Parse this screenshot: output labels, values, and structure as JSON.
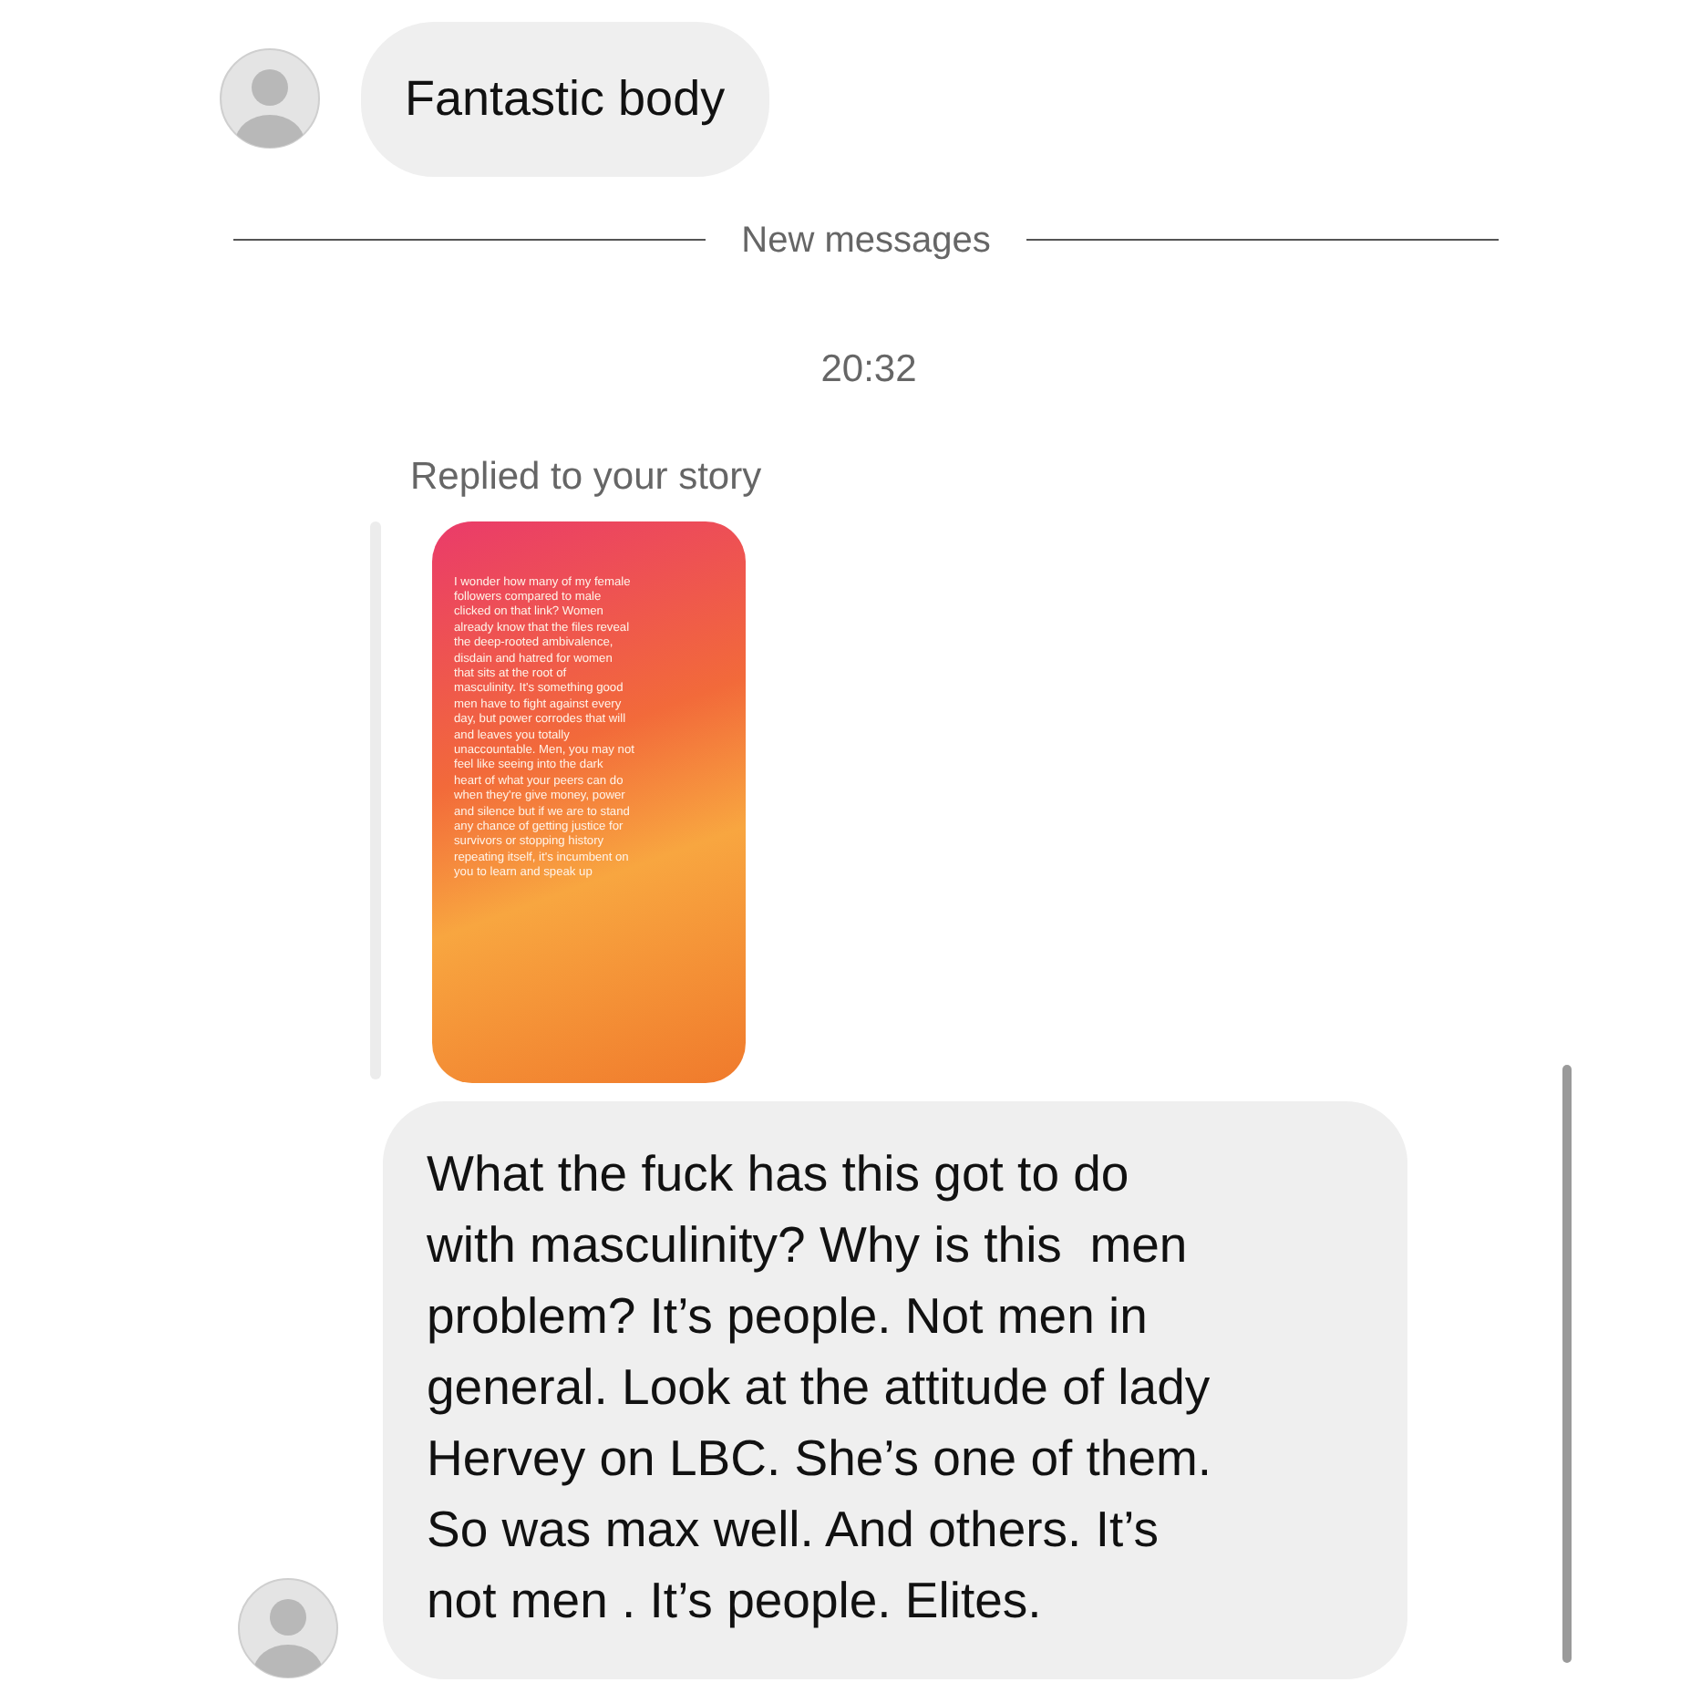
{
  "messages_before": [
    {
      "text": "Fantastic body"
    }
  ],
  "divider": {
    "label": "New messages"
  },
  "timestamp": "20:32",
  "story_reply": {
    "label": "Replied to your story",
    "story_lines": [
      "I wonder how many of my female",
      "followers compared to male",
      "clicked on that link? Women",
      "already know that the files reveal",
      "the deep-rooted ambivalence,",
      "disdain and hatred for women",
      "that sits at the root of",
      "masculinity. It's something good",
      "men have to fight against every",
      "day, but power corrodes that will",
      "and leaves you totally",
      "unaccountable. Men, you may not",
      "feel like seeing into the dark",
      "heart of what your peers can do",
      "when they're give money, power",
      "and silence but if we are to stand",
      "any chance of getting justice for",
      "survivors or stopping history",
      "repeating itself, it's incumbent on",
      "you to learn and speak up"
    ]
  },
  "message": {
    "lines": [
      "What the fuck has this got to do",
      "with masculinity? Why is this  men",
      "problem? It’s people. Not men in",
      "general. Look at the attitude of lady",
      "Hervey on LBC. She’s one of them.",
      "So was max well. And others. It’s",
      "not men . It’s people. Elites."
    ]
  }
}
